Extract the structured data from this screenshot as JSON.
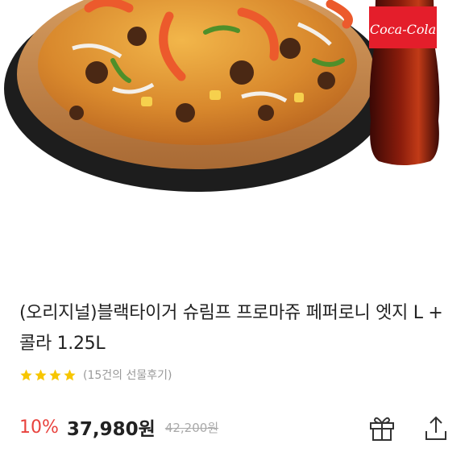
{
  "product": {
    "image_alt": "pizza and cola product image",
    "bottle_brand": "Coca-Cola",
    "title": "(오리지널)블랙타이거 슈림프 프로마쥬 페퍼로니 엣지 L + 콜라 1.25L",
    "rating": {
      "stars": 4,
      "review_text": "(15건의 선물후기)"
    },
    "price": {
      "discount": "10%",
      "current": "37,980원",
      "original": "42,200원"
    }
  },
  "actions": {
    "gift_icon": "gift-icon",
    "share_icon": "share-icon"
  },
  "colors": {
    "accent": "#e8423d",
    "star": "#f7c600",
    "text": "#222222",
    "muted": "#999999"
  }
}
